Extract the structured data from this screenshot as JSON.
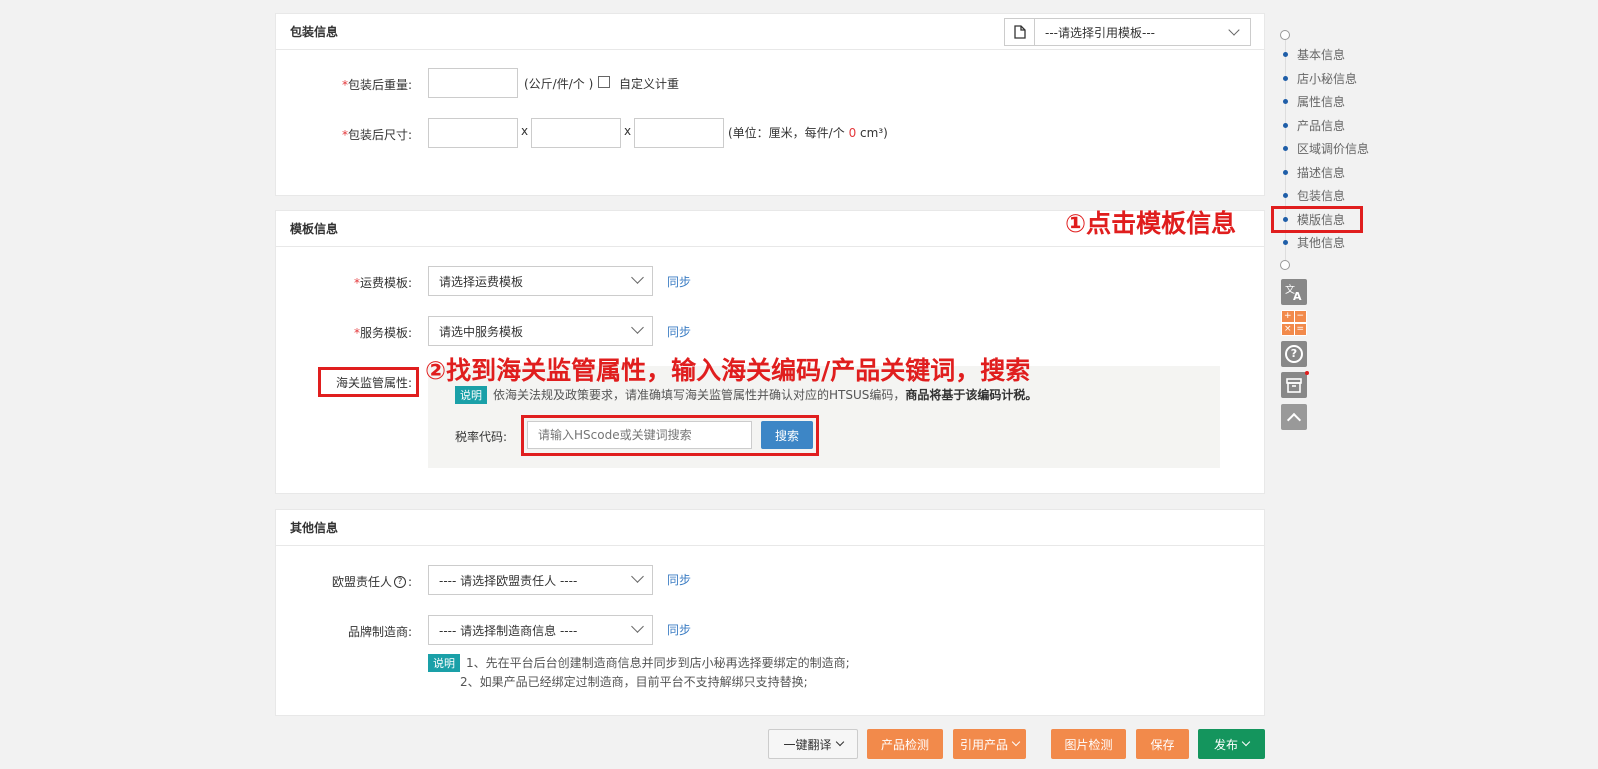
{
  "packaging": {
    "title": "包装信息",
    "template_select": "---请选择引用模板---",
    "weight_label": "包装后重量:",
    "weight_unit": "(公斤/件/个 )",
    "custom_weight_label": "自定义计重",
    "size_label": "包装后尺寸:",
    "times_1": "x",
    "times_2": "x",
    "size_unit_prefix": "(单位：厘米，每件/个",
    "size_unit_value": "0",
    "size_unit_suffix": "cm³)"
  },
  "template_info": {
    "title": "模板信息",
    "freight_label": "运费模板:",
    "freight_select": "请选择运费模板",
    "freight_sync": "同步",
    "service_label": "服务模板:",
    "service_select": "请选中服务模板",
    "service_sync": "同步",
    "customs_label": "海关监管属性:",
    "note_tag": "说明",
    "note_text": "依海关法规及政策要求，请准确填写海关监管属性并确认对应的HTSUS编码，",
    "note_bold": "商品将基于该编码计税。",
    "tax_label": "税率代码:",
    "tax_placeholder": "请输入HScode或关键词搜索",
    "search_button": "搜索"
  },
  "other_info": {
    "title": "其他信息",
    "eu_label": "欧盟责任人",
    "eu_select": "---- 请选择欧盟责任人 ----",
    "eu_sync": "同步",
    "brand_label": "品牌制造商:",
    "brand_select": "---- 请选择制造商信息 ----",
    "brand_sync": "同步",
    "note_tag": "说明",
    "note_line1": "1、先在平台后台创建制造商信息并同步到店小秘再选择要绑定的制造商;",
    "note_line2": "2、如果产品已经绑定过制造商，目前平台不支持解绑只支持替换;"
  },
  "annotations": {
    "step1": "①点击模板信息",
    "step2": "②找到海关监管属性，输入海关编码/产品关键词，搜索"
  },
  "side_nav": {
    "items": [
      "基本信息",
      "店小秘信息",
      "属性信息",
      "产品信息",
      "区域调价信息",
      "描述信息",
      "包装信息",
      "模版信息",
      "其他信息"
    ]
  },
  "side_tools": {
    "translate_icon": "translate-icon",
    "calculator_icon": "calculator-icon",
    "help_icon": "help-icon",
    "archive_icon": "archive-icon",
    "top_icon": "back-to-top-icon"
  },
  "footer": {
    "translate_button": "一键翻译",
    "check_button": "产品检测",
    "quote_button": "引用产品",
    "image_check_button": "图片检测",
    "save_button": "保存",
    "publish_button": "发布"
  },
  "colors": {
    "orange": "#f28a4b",
    "green": "#14955d",
    "annotation": "#e01e1e",
    "link": "#3d7ec4"
  }
}
